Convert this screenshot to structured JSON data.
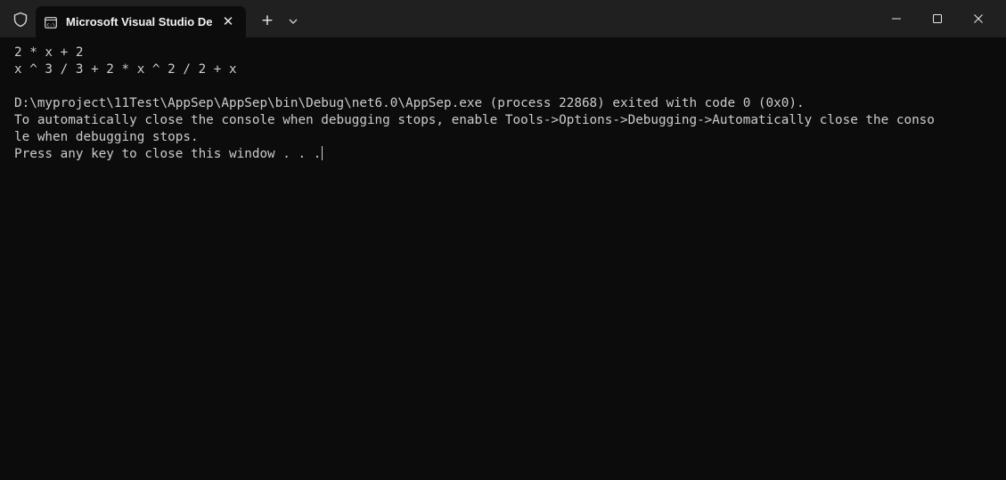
{
  "tab": {
    "title": "Microsoft Visual Studio Debug Console",
    "close_label": "✕"
  },
  "titlebar": {
    "new_tab_label": "+"
  },
  "console": {
    "lines": [
      "2 * x + 2",
      "x ^ 3 / 3 + 2 * x ^ 2 / 2 + x",
      "",
      "D:\\myproject\\11Test\\AppSep\\AppSep\\bin\\Debug\\net6.0\\AppSep.exe (process 22868) exited with code 0 (0x0).",
      "To automatically close the console when debugging stops, enable Tools->Options->Debugging->Automatically close the conso",
      "le when debugging stops.",
      "Press any key to close this window . . ."
    ]
  },
  "colors": {
    "titlebar": "#202020",
    "console_bg": "#0c0c0c",
    "console_fg": "#cccccc"
  },
  "icons": {
    "shield": "shield-icon",
    "terminal": "terminal-icon",
    "dropdown": "chevron-down-icon",
    "minimize": "minimize-icon",
    "maximize": "maximize-icon",
    "close": "close-icon"
  }
}
